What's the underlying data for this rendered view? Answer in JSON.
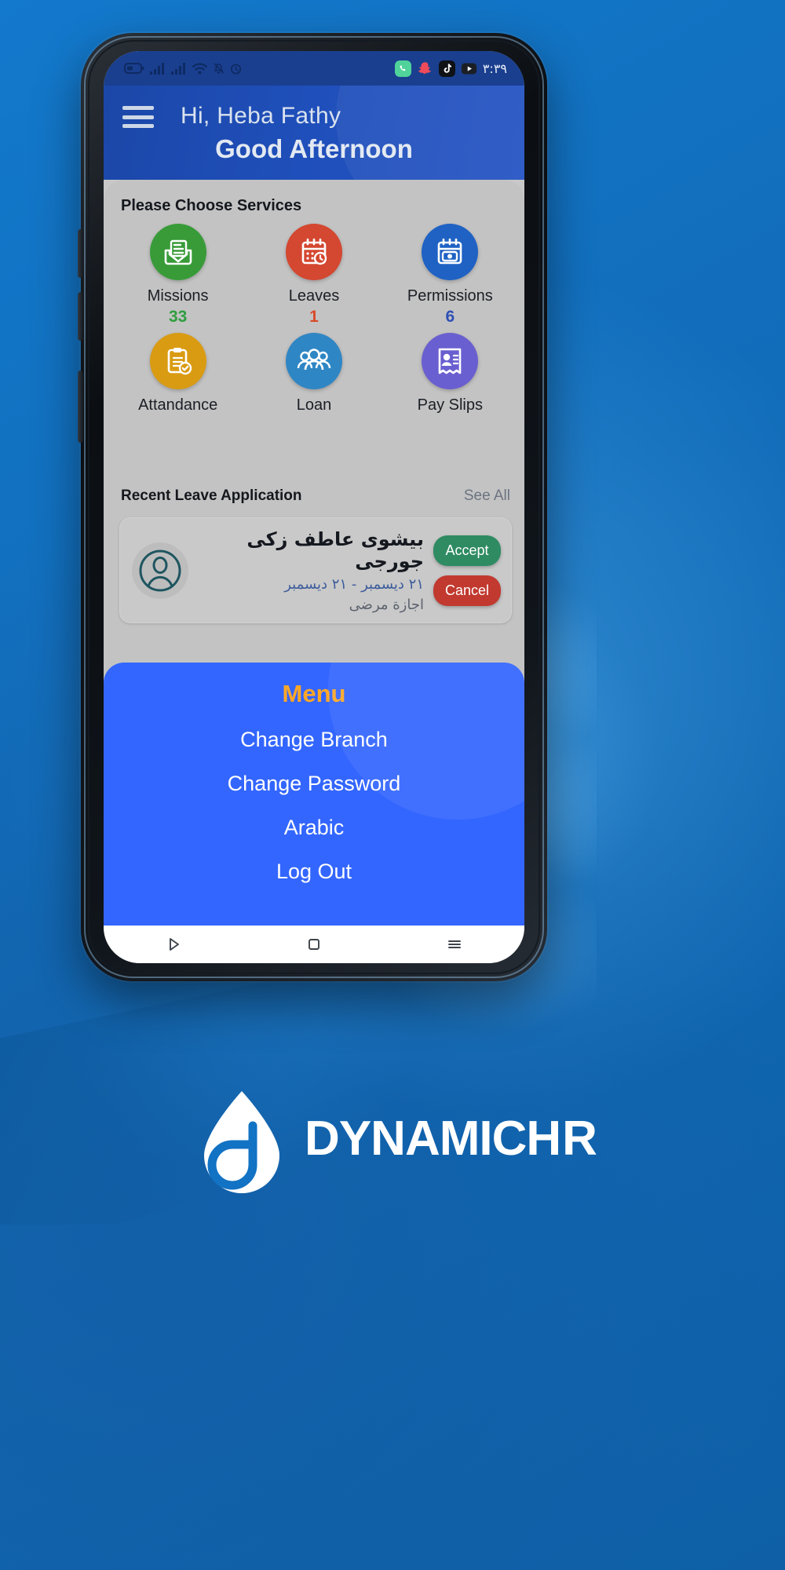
{
  "statusbar": {
    "time": "٣:٣٩",
    "left_icons": [
      "battery-icon",
      "signal-icon",
      "signal-icon",
      "wifi-icon",
      "bell-mute-icon",
      "alarm-icon"
    ],
    "right_icons": [
      "whatsapp-icon",
      "snapchat-icon",
      "tiktok-icon",
      "youtube-icon"
    ]
  },
  "header": {
    "menu_icon": "hamburger-icon",
    "greeting_name": "Hi, Heba Fathy",
    "greeting_time": "Good Afternoon"
  },
  "services": {
    "title": "Please Choose Services",
    "items": [
      {
        "label": "Missions",
        "count": "33",
        "count_color": "#2e9e3e",
        "icon": "envelope-document-icon",
        "bg": "#389b38"
      },
      {
        "label": "Leaves",
        "count": "1",
        "count_color": "#d94a2b",
        "icon": "calendar-clock-icon",
        "bg": "#d44730"
      },
      {
        "label": "Permissions",
        "count": "6",
        "count_color": "#2f4fb5",
        "icon": "calendar-camera-icon",
        "bg": "#1f62c4"
      },
      {
        "label": "Attandance",
        "count": "",
        "count_color": "#d99b12",
        "icon": "clipboard-check-icon",
        "bg": "#d99b12"
      },
      {
        "label": "Loan",
        "count": "",
        "count_color": "#2f86c4",
        "icon": "people-group-icon",
        "bg": "#2f86c4"
      },
      {
        "label": "Pay Slips",
        "count": "",
        "count_color": "#6a5fd0",
        "icon": "payslip-person-icon",
        "bg": "#6a5fd0"
      }
    ]
  },
  "recent": {
    "title": "Recent Leave Application",
    "see_all": "See All",
    "card": {
      "avatar_icon": "user-avatar-icon",
      "name": "بيشوى عاطف زكى جورجى",
      "dates": "٢١ ديسمبر - ٢١ ديسمبر",
      "type": "اجازة مرضى",
      "accept_label": "Accept",
      "accept_color": "#2e8b62",
      "cancel_label": "Cancel",
      "cancel_color": "#c1392f"
    }
  },
  "menu": {
    "title": "Menu",
    "title_color": "#ffa726",
    "panel_color": "#3366ff",
    "items": [
      {
        "label": "Change Branch"
      },
      {
        "label": "Change Password"
      },
      {
        "label": "Arabic"
      },
      {
        "label": "Log Out"
      }
    ]
  },
  "navbar": {
    "items": [
      {
        "icon": "back-triangle-icon"
      },
      {
        "icon": "home-square-icon"
      },
      {
        "icon": "recents-lines-icon"
      }
    ]
  },
  "brand": {
    "logo_icon": "dynamic-hr-drop-logo",
    "name_main": "DYNAMIC",
    "name_accent": "HR"
  }
}
